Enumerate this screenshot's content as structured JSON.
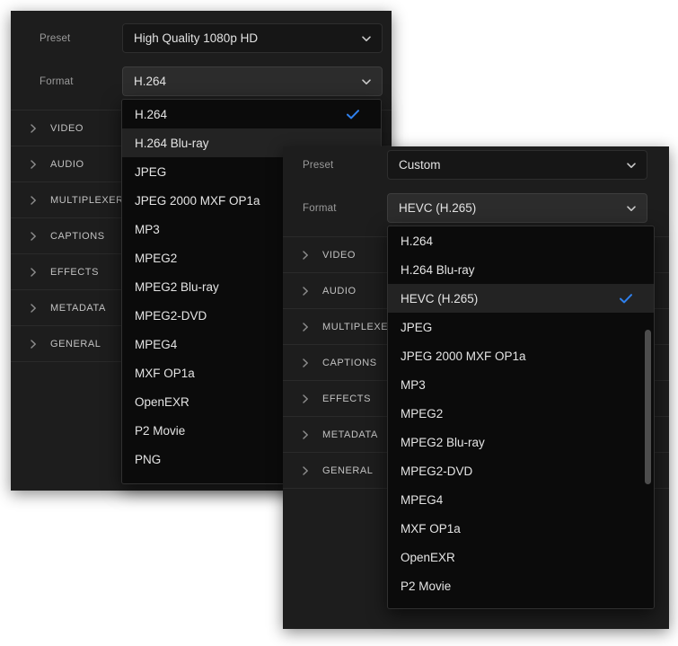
{
  "panel_one": {
    "preset": {
      "label": "Preset",
      "value": "High Quality 1080p HD"
    },
    "format": {
      "label": "Format",
      "value": "H.264"
    },
    "sections": [
      {
        "label": "VIDEO"
      },
      {
        "label": "AUDIO"
      },
      {
        "label": "MULTIPLEXER"
      },
      {
        "label": "CAPTIONS"
      },
      {
        "label": "EFFECTS"
      },
      {
        "label": "METADATA"
      },
      {
        "label": "GENERAL"
      }
    ],
    "format_dropdown": {
      "selected": "H.264",
      "highlighted": "H.264 Blu-ray",
      "options": [
        "H.264",
        "H.264 Blu-ray",
        "JPEG",
        "JPEG 2000 MXF OP1a",
        "MP3",
        "MPEG2",
        "MPEG2 Blu-ray",
        "MPEG2-DVD",
        "MPEG4",
        "MXF OP1a",
        "OpenEXR",
        "P2 Movie",
        "PNG"
      ]
    }
  },
  "panel_two": {
    "preset": {
      "label": "Preset",
      "value": "Custom"
    },
    "format": {
      "label": "Format",
      "value": "HEVC (H.265)"
    },
    "sections": [
      {
        "label": "VIDEO"
      },
      {
        "label": "AUDIO"
      },
      {
        "label": "MULTIPLEXER"
      },
      {
        "label": "CAPTIONS"
      },
      {
        "label": "EFFECTS"
      },
      {
        "label": "METADATA"
      },
      {
        "label": "GENERAL"
      }
    ],
    "format_dropdown": {
      "selected": "HEVC (H.265)",
      "highlighted": "HEVC (H.265)",
      "options": [
        "H.264",
        "H.264 Blu-ray",
        "HEVC (H.265)",
        "JPEG",
        "JPEG 2000 MXF OP1a",
        "MP3",
        "MPEG2",
        "MPEG2 Blu-ray",
        "MPEG2-DVD",
        "MPEG4",
        "MXF OP1a",
        "OpenEXR",
        "P2 Movie"
      ],
      "scrollbar_visible": true
    }
  },
  "icons": {
    "chevron_down": "chevron-down-icon",
    "chevron_right": "chevron-right-icon",
    "check": "check-icon"
  },
  "colors": {
    "accent": "#2f80ed",
    "panel_bg": "#1d1d1d",
    "dropdown_bg": "#0b0b0b",
    "field_bg": "#161616",
    "field_active_bg": "#2c2c2c",
    "text": "#e4e4e4",
    "label_text": "#9a9a9a"
  }
}
